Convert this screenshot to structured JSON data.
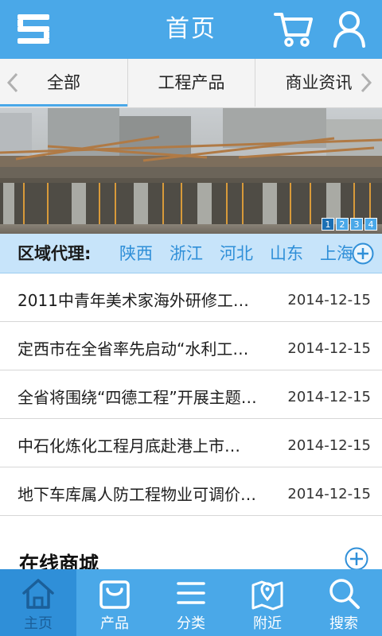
{
  "header": {
    "title": "首页",
    "icons": {
      "menu": "menu-icon",
      "cart": "cart-icon",
      "user": "user-icon"
    }
  },
  "tabs": {
    "items": [
      {
        "label": "全部"
      },
      {
        "label": "工程产品"
      },
      {
        "label": "商业资讯"
      }
    ],
    "selected": "全部"
  },
  "banner": {
    "pages": [
      "1",
      "2",
      "3",
      "4"
    ],
    "active": "1"
  },
  "region": {
    "label": "区域代理:",
    "provinces": [
      "陕西",
      "浙江",
      "河北",
      "山东",
      "上海"
    ]
  },
  "news": [
    {
      "title": "2011中青年美术家海外研修工…",
      "date": "2014-12-15"
    },
    {
      "title": "定西市在全省率先启动“水利工…",
      "date": "2014-12-15"
    },
    {
      "title": "全省将围绕“四德工程”开展主题…",
      "date": "2014-12-15"
    },
    {
      "title": "中石化炼化工程月底赴港上市…",
      "date": "2014-12-15"
    },
    {
      "title": "地下车库属人防工程物业可调价…",
      "date": "2014-12-15"
    }
  ],
  "section": {
    "title": "在线商城"
  },
  "bottom_nav": [
    {
      "label": "主页",
      "icon": "home-icon"
    },
    {
      "label": "产品",
      "icon": "bag-icon"
    },
    {
      "label": "分类",
      "icon": "list-icon"
    },
    {
      "label": "附近",
      "icon": "map-pin-icon"
    },
    {
      "label": "搜索",
      "icon": "search-icon"
    }
  ],
  "colors": {
    "primary": "#4aa8e8",
    "primary_dark": "#2f8fd8",
    "region_bg": "#c7e4fa",
    "province_text": "#2f8fd8"
  }
}
